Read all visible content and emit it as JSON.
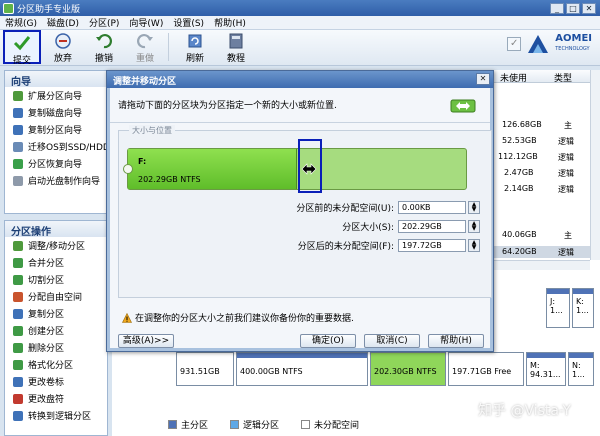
{
  "app": {
    "title": "分区助手专业版"
  },
  "window_buttons": {
    "minimize": "_",
    "maximize": "□",
    "close": "✕"
  },
  "menu": [
    "常规(G)",
    "磁盘(D)",
    "分区(P)",
    "向导(W)",
    "设置(S)",
    "帮助(H)"
  ],
  "toolbar": {
    "buttons": [
      {
        "label": "提交",
        "icon": "check-icon"
      },
      {
        "label": "放弃",
        "icon": "discard-icon"
      },
      {
        "label": "撤销",
        "icon": "undo-icon"
      },
      {
        "label": "重做",
        "icon": "redo-icon"
      },
      {
        "label": "刷新",
        "icon": "refresh-icon"
      },
      {
        "label": "教程",
        "icon": "tutorial-icon"
      }
    ],
    "brand": "AOMEI",
    "brand_sub": "TECHNOLOGY"
  },
  "sidebar": {
    "wizard_title": "向导",
    "wizard_items": [
      "扩展分区向导",
      "复制磁盘向导",
      "复制分区向导",
      "迁移OS到SSD/HDD",
      "分区恢复向导",
      "启动光盘制作向导"
    ],
    "ops_title": "分区操作",
    "ops_items": [
      "调整/移动分区",
      "合并分区",
      "切割分区",
      "分配自由空间",
      "复制分区",
      "创建分区",
      "删除分区",
      "格式化分区",
      "更改卷标",
      "更改盘符",
      "转换到逻辑分区"
    ]
  },
  "table": {
    "headers": [
      "未使用",
      "类型"
    ],
    "rows": [
      {
        "unused": "126.68GB",
        "type": "主"
      },
      {
        "unused": "52.53GB",
        "type": "逻辑"
      },
      {
        "unused": "112.12GB",
        "type": "逻辑"
      },
      {
        "unused": "2.47GB",
        "type": "逻辑"
      },
      {
        "unused": "2.14GB",
        "type": "逻辑"
      },
      {
        "unused": "40.06GB",
        "type": "主"
      },
      {
        "unused": "64.20GB",
        "type": "逻辑"
      }
    ]
  },
  "disk_map": {
    "top_blocks": [
      {
        "label": "J:",
        "sub": "1..."
      },
      {
        "label": "K:",
        "sub": "1..."
      }
    ],
    "bottom_blocks": [
      {
        "line1": "",
        "line2": "931.51GB"
      },
      {
        "line1": "",
        "line2": "400.00GB NTFS"
      },
      {
        "line1": "",
        "line2": "202.30GB NTFS"
      },
      {
        "line1": "",
        "line2": "197.71GB Free"
      },
      {
        "line1": "M:",
        "line2": "94.31..."
      },
      {
        "line1": "N:",
        "line2": "1..."
      }
    ]
  },
  "legend": [
    "主分区",
    "逻辑分区",
    "未分配空间"
  ],
  "dialog": {
    "title": "调整并移动分区",
    "close": "✕",
    "instruction": "请拖动下面的分区块为分区指定一个新的大小或新位置.",
    "group_label": "大小与位置",
    "partition": {
      "letter": "F:",
      "size": "202.29GB NTFS",
      "fill_fraction": 0.5
    },
    "fields": [
      {
        "label": "分区前的未分配空间(U):",
        "value": "0.00KB"
      },
      {
        "label": "分区大小(S):",
        "value": "202.29GB"
      },
      {
        "label": "分区后的未分配空间(F):",
        "value": "197.72GB"
      }
    ],
    "warning": "在调整你的分区大小之前我们建议你备份你的重要数据.",
    "buttons": {
      "advanced": "高级(A)>>",
      "ok": "确定(O)",
      "cancel": "取消(C)",
      "help": "帮助(H)"
    }
  },
  "watermark": "知乎 @Vista-Y",
  "colors": {
    "highlight": "#0a1fb8",
    "partition_green": "#5fbd2a",
    "primary_blue": "#4f72b6"
  }
}
